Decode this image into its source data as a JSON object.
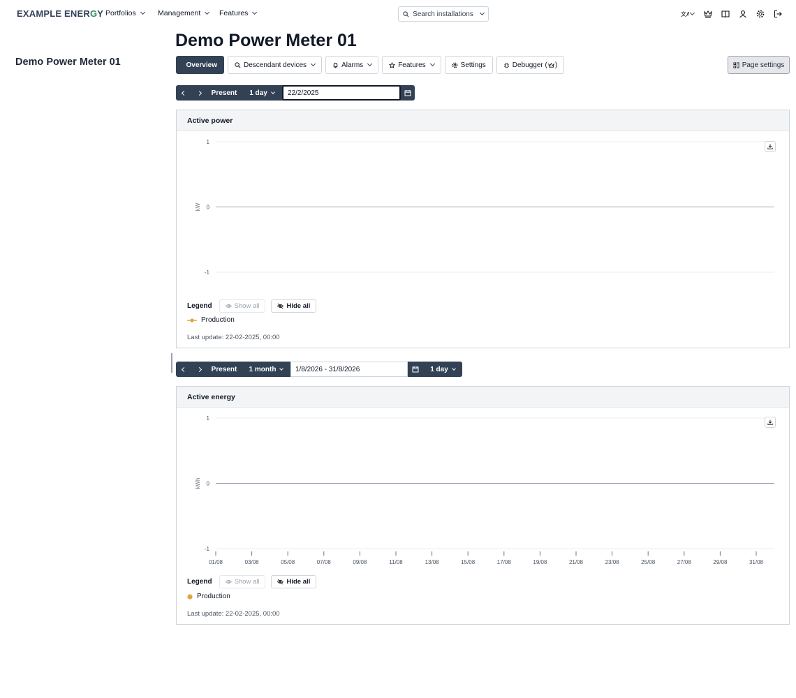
{
  "nav": {
    "logo_pre": "EXAMPLE ENER",
    "logo_o": "G",
    "logo_post": "Y",
    "menus": [
      "Portfolios",
      "Management",
      "Features"
    ],
    "search_label": "Search installations",
    "icons": [
      "translate-icon",
      "crown-icon",
      "book-icon",
      "user-icon",
      "gear-icon",
      "logout-icon"
    ]
  },
  "sidebar": {
    "title": "Demo Power Meter 01"
  },
  "page": {
    "title": "Demo Power Meter 01"
  },
  "tabs": {
    "overview": "Overview",
    "descendant": "Descendant devices",
    "alarms": "Alarms",
    "features": "Features",
    "settings": "Settings",
    "debugger": "Debugger (",
    "debugger_end": ")"
  },
  "page_settings_label": "Page settings",
  "power_toolbar": {
    "present": "Present",
    "range": "1 day",
    "date_value": "22/2/2025"
  },
  "energy_toolbar": {
    "present": "Present",
    "range": "1 month",
    "date_value": "1/8/2026 - 31/8/2026",
    "resolution": "1 day"
  },
  "colors": {
    "accent": "#334155",
    "production": "#e5a13a",
    "zero_line": "#9ca3af",
    "grid": "#eeeeee"
  },
  "legend": {
    "label": "Legend",
    "show_all": "Show all",
    "hide_all": "Hide all"
  },
  "power_card": {
    "title": "Active power",
    "last_update": "Last update: 22-02-2025, 00:00"
  },
  "energy_card": {
    "title": "Active energy",
    "last_update": "Last update: 22-02-2025, 00:00"
  },
  "chart_data": [
    {
      "type": "line",
      "title": "Active power",
      "ylabel": "kW",
      "ylim": [
        -1,
        1
      ],
      "yticks": [
        "1",
        "0",
        "-1"
      ],
      "series": [
        {
          "name": "Production",
          "values": []
        }
      ],
      "legend": "bottom-left",
      "grid": true
    },
    {
      "type": "bar",
      "title": "Active energy",
      "ylabel": "kWh",
      "ylim": [
        -1,
        1
      ],
      "yticks": [
        "1",
        "0",
        "-1"
      ],
      "categories": [
        "01/08",
        "03/08",
        "05/08",
        "07/08",
        "09/08",
        "11/08",
        "13/08",
        "15/08",
        "17/08",
        "19/08",
        "21/08",
        "23/08",
        "25/08",
        "27/08",
        "29/08",
        "31/08"
      ],
      "series": [
        {
          "name": "Production",
          "values": []
        }
      ],
      "legend": "bottom-left",
      "grid": true
    }
  ]
}
